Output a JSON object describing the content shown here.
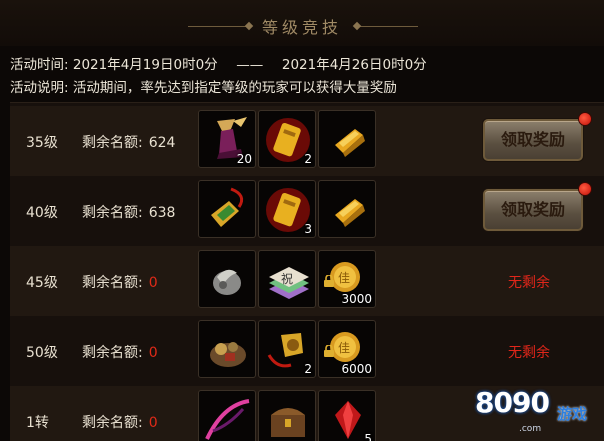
{
  "header": {
    "title": "等级竞技"
  },
  "activity": {
    "time_label": "活动时间:",
    "start": "2021年4月19日0时0分",
    "separator": "——",
    "end": "2021年4月26日0时0分",
    "desc_label": "活动说明:",
    "desc": "活动期间，率先达到指定等级的玩家可以获得大量奖励"
  },
  "quota_label": "剩余名额:",
  "rows": [
    {
      "level": "35级",
      "remaining": "624",
      "rewards": [
        {
          "icon": "winged-boots-icon",
          "count": "20"
        },
        {
          "icon": "gold-ticket-icon",
          "count": "2"
        },
        {
          "icon": "gold-ingot-icon",
          "count": ""
        }
      ],
      "action": "领取奖励"
    },
    {
      "level": "40级",
      "remaining": "638",
      "rewards": [
        {
          "icon": "jade-pendant-icon",
          "count": ""
        },
        {
          "icon": "gold-ticket-icon",
          "count": "3"
        },
        {
          "icon": "gold-ingot-icon",
          "count": ""
        }
      ],
      "action": "领取奖励"
    },
    {
      "level": "45级",
      "remaining": "0",
      "rewards": [
        {
          "icon": "silver-ore-icon",
          "count": ""
        },
        {
          "icon": "scroll-stack-icon",
          "count": ""
        },
        {
          "icon": "locked-coin-icon",
          "count": "3000"
        }
      ],
      "status": "无剩余"
    },
    {
      "level": "50级",
      "remaining": "0",
      "rewards": [
        {
          "icon": "treasure-pile-icon",
          "count": ""
        },
        {
          "icon": "gold-pendant-icon",
          "count": "2"
        },
        {
          "icon": "locked-coin-icon",
          "count": "6000"
        }
      ],
      "status": "无剩余"
    },
    {
      "level": "1转",
      "remaining": "0",
      "rewards": [
        {
          "icon": "pink-bow-icon",
          "count": ""
        },
        {
          "icon": "treasure-chest-icon",
          "count": ""
        },
        {
          "icon": "red-gem-icon",
          "count": "5"
        }
      ],
      "status": ""
    }
  ],
  "watermark": {
    "digits": "8090",
    "text": "游戏",
    "domain": ".com"
  }
}
